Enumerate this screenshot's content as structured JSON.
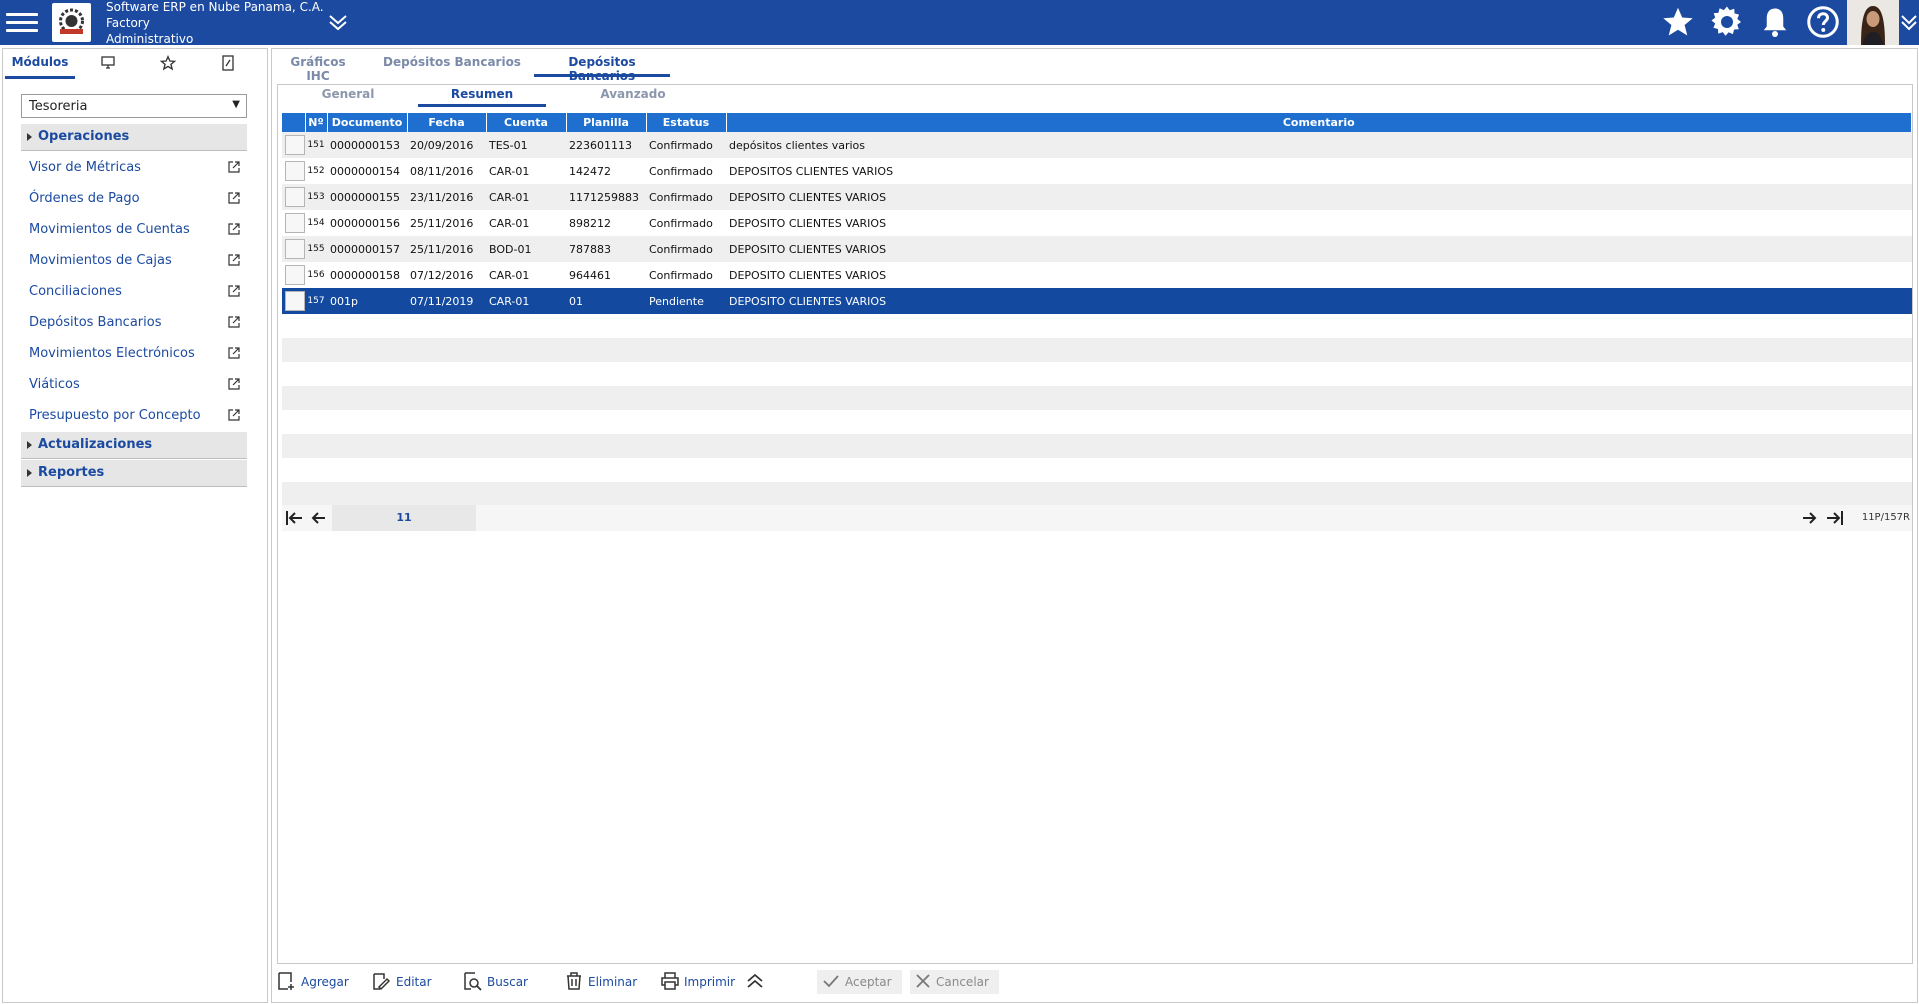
{
  "header": {
    "company_line1": "Software ERP en Nube Panama, C.A.",
    "company_line2": "Factory",
    "company_line3": "Administrativo"
  },
  "left": {
    "tabs": [
      "Módulos"
    ],
    "module_selected": "Tesoreria",
    "sections": {
      "operaciones": "Operaciones",
      "actualizaciones": "Actualizaciones",
      "reportes": "Reportes"
    },
    "items": [
      "Visor de Métricas",
      "Órdenes de Pago",
      "Movimientos de Cuentas",
      "Movimientos de Cajas",
      "Conciliaciones",
      "Depósitos Bancarios",
      "Movimientos Electrónicos",
      "Viáticos",
      "Presupuesto por Concepto"
    ]
  },
  "main": {
    "tabs": [
      "Gráficos IHC",
      "Depósitos Bancarios",
      "Depósitos Bancarios"
    ],
    "subtabs": [
      "General",
      "Resumen",
      "Avanzado"
    ]
  },
  "grid": {
    "columns": [
      "Nº",
      "Documento",
      "Fecha",
      "Cuenta",
      "Planilla",
      "Estatus",
      "Comentario"
    ],
    "rows": [
      {
        "n": "151",
        "doc": "0000000153",
        "fecha": "20/09/2016",
        "cuenta": "TES-01",
        "planilla": "223601113",
        "estatus": "Confirmado",
        "comentario": "depósitos clientes varios"
      },
      {
        "n": "152",
        "doc": "0000000154",
        "fecha": "08/11/2016",
        "cuenta": "CAR-01",
        "planilla": "142472",
        "estatus": "Confirmado",
        "comentario": "DEPOSITOS CLIENTES VARIOS"
      },
      {
        "n": "153",
        "doc": "0000000155",
        "fecha": "23/11/2016",
        "cuenta": "CAR-01",
        "planilla": "1171259883",
        "estatus": "Confirmado",
        "comentario": "DEPOSITO CLIENTES VARIOS"
      },
      {
        "n": "154",
        "doc": "0000000156",
        "fecha": "25/11/2016",
        "cuenta": "CAR-01",
        "planilla": "898212",
        "estatus": "Confirmado",
        "comentario": "DEPOSITO CLIENTES VARIOS"
      },
      {
        "n": "155",
        "doc": "0000000157",
        "fecha": "25/11/2016",
        "cuenta": "BOD-01",
        "planilla": "787883",
        "estatus": "Confirmado",
        "comentario": "DEPOSITO CLIENTES VARIOS"
      },
      {
        "n": "156",
        "doc": "0000000158",
        "fecha": "07/12/2016",
        "cuenta": "CAR-01",
        "planilla": "964461",
        "estatus": "Confirmado",
        "comentario": "DEPOSITO CLIENTES VARIOS"
      },
      {
        "n": "157",
        "doc": "001p",
        "fecha": "07/11/2019",
        "cuenta": "CAR-01",
        "planilla": "01",
        "estatus": "Pendiente",
        "comentario": "DEPOSITO CLIENTES VARIOS"
      }
    ]
  },
  "pager": {
    "page": "11",
    "info": "11P/157R"
  },
  "toolbar": {
    "agregar": "Agregar",
    "editar": "Editar",
    "buscar": "Buscar",
    "eliminar": "Eliminar",
    "imprimir": "Imprimir",
    "aceptar": "Aceptar",
    "cancelar": "Cancelar"
  }
}
